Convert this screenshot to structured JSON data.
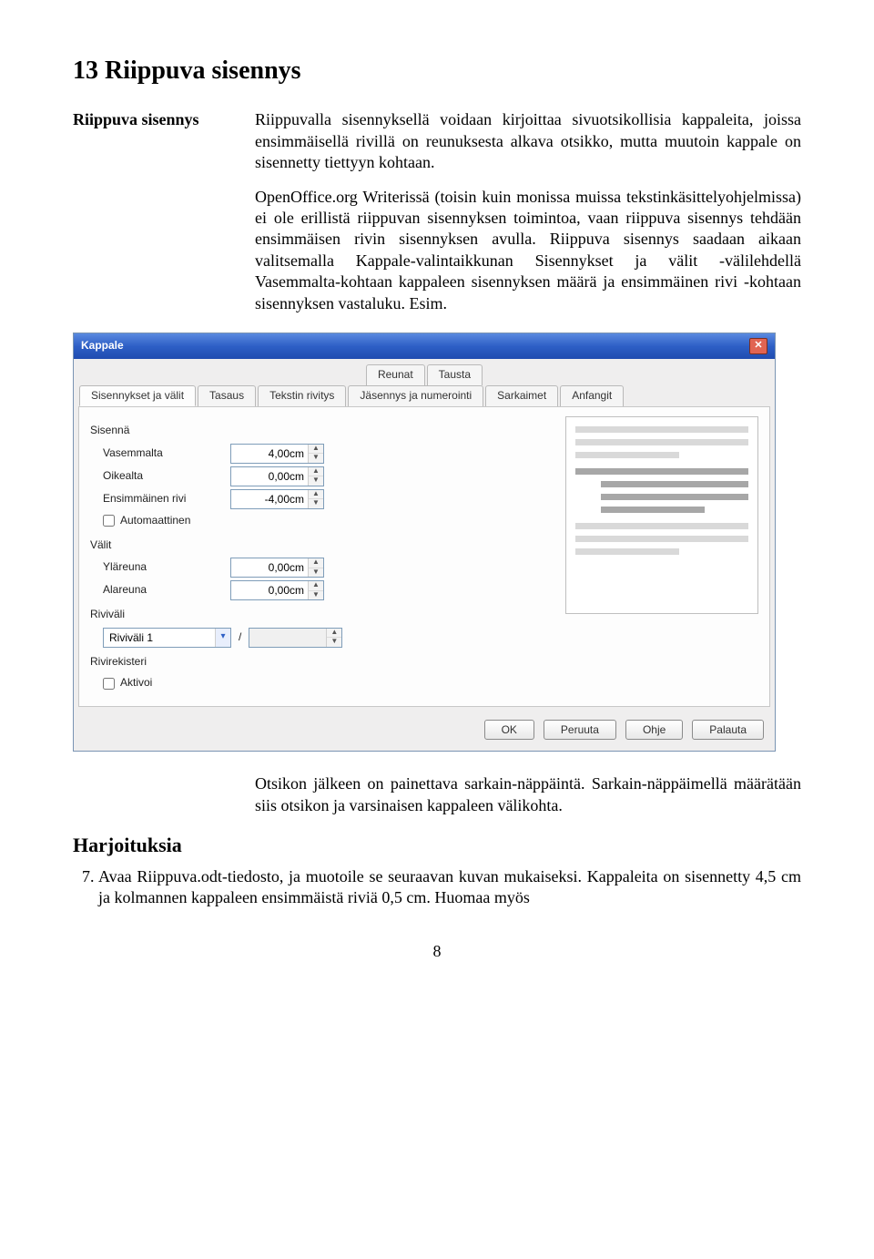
{
  "title": "13 Riippuva sisennys",
  "side_label": "Riippuva sisennys",
  "para1": "Riippuvalla sisennyksellä voidaan kirjoittaa sivuotsikollisia kappaleita, joissa ensimmäisellä rivillä on reunuksesta alkava otsikko, mutta muutoin kappale on sisennetty tiettyyn kohtaan.",
  "para2": "OpenOffice.org Writerissä (toisin kuin monissa muissa tekstinkäsittelyohjelmissa) ei ole erillistä riippuvan sisennyksen toimintoa, vaan riippuva sisennys tehdään ensimmäisen rivin sisennyksen avulla. Riippuva sisennys saadaan aikaan valitsemalla Kappale-valintaikkunan Sisennykset ja välit -välilehdellä Vasemmalta-kohtaan kappaleen sisennyksen määrä ja ensimmäinen rivi -kohtaan sisennyksen vastaluku. Esim.",
  "para3": "Otsikon jälkeen on painettava sarkain-näppäintä. Sarkain-näppäimellä määrätään siis otsikon ja varsinaisen kappaleen välikohta.",
  "exercises_title": "Harjoituksia",
  "exercise_num": "7.",
  "exercise_text": "Avaa Riippuva.odt-tiedosto, ja muotoile se seuraavan kuvan mukaiseksi. Kappaleita on sisennetty 4,5 cm ja kolmannen kappaleen ensimmäistä riviä 0,5 cm. Huomaa myös",
  "page_number": "8",
  "dialog": {
    "title": "Kappale",
    "tabs_top": [
      "Reunat",
      "Tausta"
    ],
    "tabs_bottom": [
      "Sisennykset ja välit",
      "Tasaus",
      "Tekstin rivitys",
      "Jäsennys ja numerointi",
      "Sarkaimet",
      "Anfangit"
    ],
    "group_indent": "Sisennä",
    "lab_left": "Vasemmalta",
    "val_left": "4,00cm",
    "lab_right": "Oikealta",
    "val_right": "0,00cm",
    "lab_first": "Ensimmäinen rivi",
    "val_first": "-4,00cm",
    "cb_auto": "Automaattinen",
    "group_spacing": "Välit",
    "lab_top": "Yläreuna",
    "val_top": "0,00cm",
    "lab_bot": "Alareuna",
    "val_bot": "0,00cm",
    "group_linespacing": "Riviväli",
    "combo_val": "Riviväli 1",
    "slash": "/",
    "group_register": "Rivirekisteri",
    "cb_activate": "Aktivoi",
    "btn_ok": "OK",
    "btn_cancel": "Peruuta",
    "btn_help": "Ohje",
    "btn_reset": "Palauta"
  }
}
